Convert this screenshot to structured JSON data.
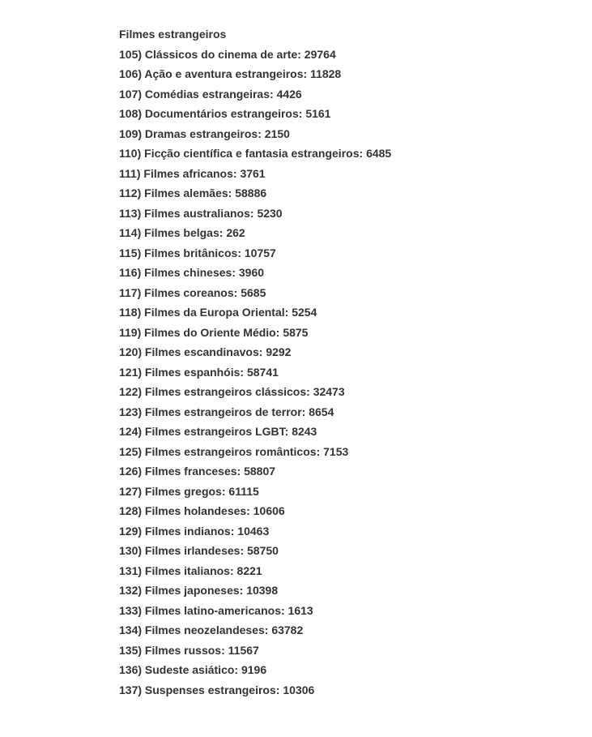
{
  "heading": "Filmes estrangeiros",
  "items": [
    {
      "num": 105,
      "name": "Clássicos do cinema de arte",
      "code": 29764
    },
    {
      "num": 106,
      "name": "Ação e aventura estrangeiros",
      "code": 11828
    },
    {
      "num": 107,
      "name": "Comédias estrangeiras",
      "code": 4426
    },
    {
      "num": 108,
      "name": "Documentários estrangeiros",
      "code": 5161
    },
    {
      "num": 109,
      "name": "Dramas estrangeiros",
      "code": 2150
    },
    {
      "num": 110,
      "name": "Ficção científica e fantasia estrangeiros",
      "code": 6485
    },
    {
      "num": 111,
      "name": "Filmes africanos",
      "code": 3761
    },
    {
      "num": 112,
      "name": "Filmes alemães",
      "code": 58886
    },
    {
      "num": 113,
      "name": "Filmes australianos",
      "code": 5230
    },
    {
      "num": 114,
      "name": "Filmes belgas",
      "code": 262
    },
    {
      "num": 115,
      "name": "Filmes britânicos",
      "code": 10757
    },
    {
      "num": 116,
      "name": "Filmes chineses",
      "code": 3960
    },
    {
      "num": 117,
      "name": "Filmes coreanos",
      "code": 5685
    },
    {
      "num": 118,
      "name": "Filmes da Europa Oriental",
      "code": 5254
    },
    {
      "num": 119,
      "name": "Filmes do Oriente Médio",
      "code": 5875
    },
    {
      "num": 120,
      "name": "Filmes escandinavos",
      "code": 9292
    },
    {
      "num": 121,
      "name": "Filmes espanhóis",
      "code": 58741
    },
    {
      "num": 122,
      "name": "Filmes estrangeiros clássicos",
      "code": 32473
    },
    {
      "num": 123,
      "name": "Filmes estrangeiros de terror",
      "code": 8654
    },
    {
      "num": 124,
      "name": "Filmes estrangeiros LGBT",
      "code": 8243
    },
    {
      "num": 125,
      "name": "Filmes estrangeiros românticos",
      "code": 7153
    },
    {
      "num": 126,
      "name": "Filmes franceses",
      "code": 58807
    },
    {
      "num": 127,
      "name": "Filmes gregos",
      "code": 61115
    },
    {
      "num": 128,
      "name": "Filmes holandeses",
      "code": 10606
    },
    {
      "num": 129,
      "name": "Filmes indianos",
      "code": 10463
    },
    {
      "num": 130,
      "name": "Filmes irlandeses",
      "code": 58750
    },
    {
      "num": 131,
      "name": "Filmes italianos",
      "code": 8221
    },
    {
      "num": 132,
      "name": "Filmes japoneses",
      "code": 10398
    },
    {
      "num": 133,
      "name": "Filmes latino-americanos",
      "code": 1613
    },
    {
      "num": 134,
      "name": "Filmes neozelandeses",
      "code": 63782
    },
    {
      "num": 135,
      "name": "Filmes russos",
      "code": 11567
    },
    {
      "num": 136,
      "name": "Sudeste asiático",
      "code": 9196
    },
    {
      "num": 137,
      "name": "Suspenses estrangeiros",
      "code": 10306
    }
  ]
}
